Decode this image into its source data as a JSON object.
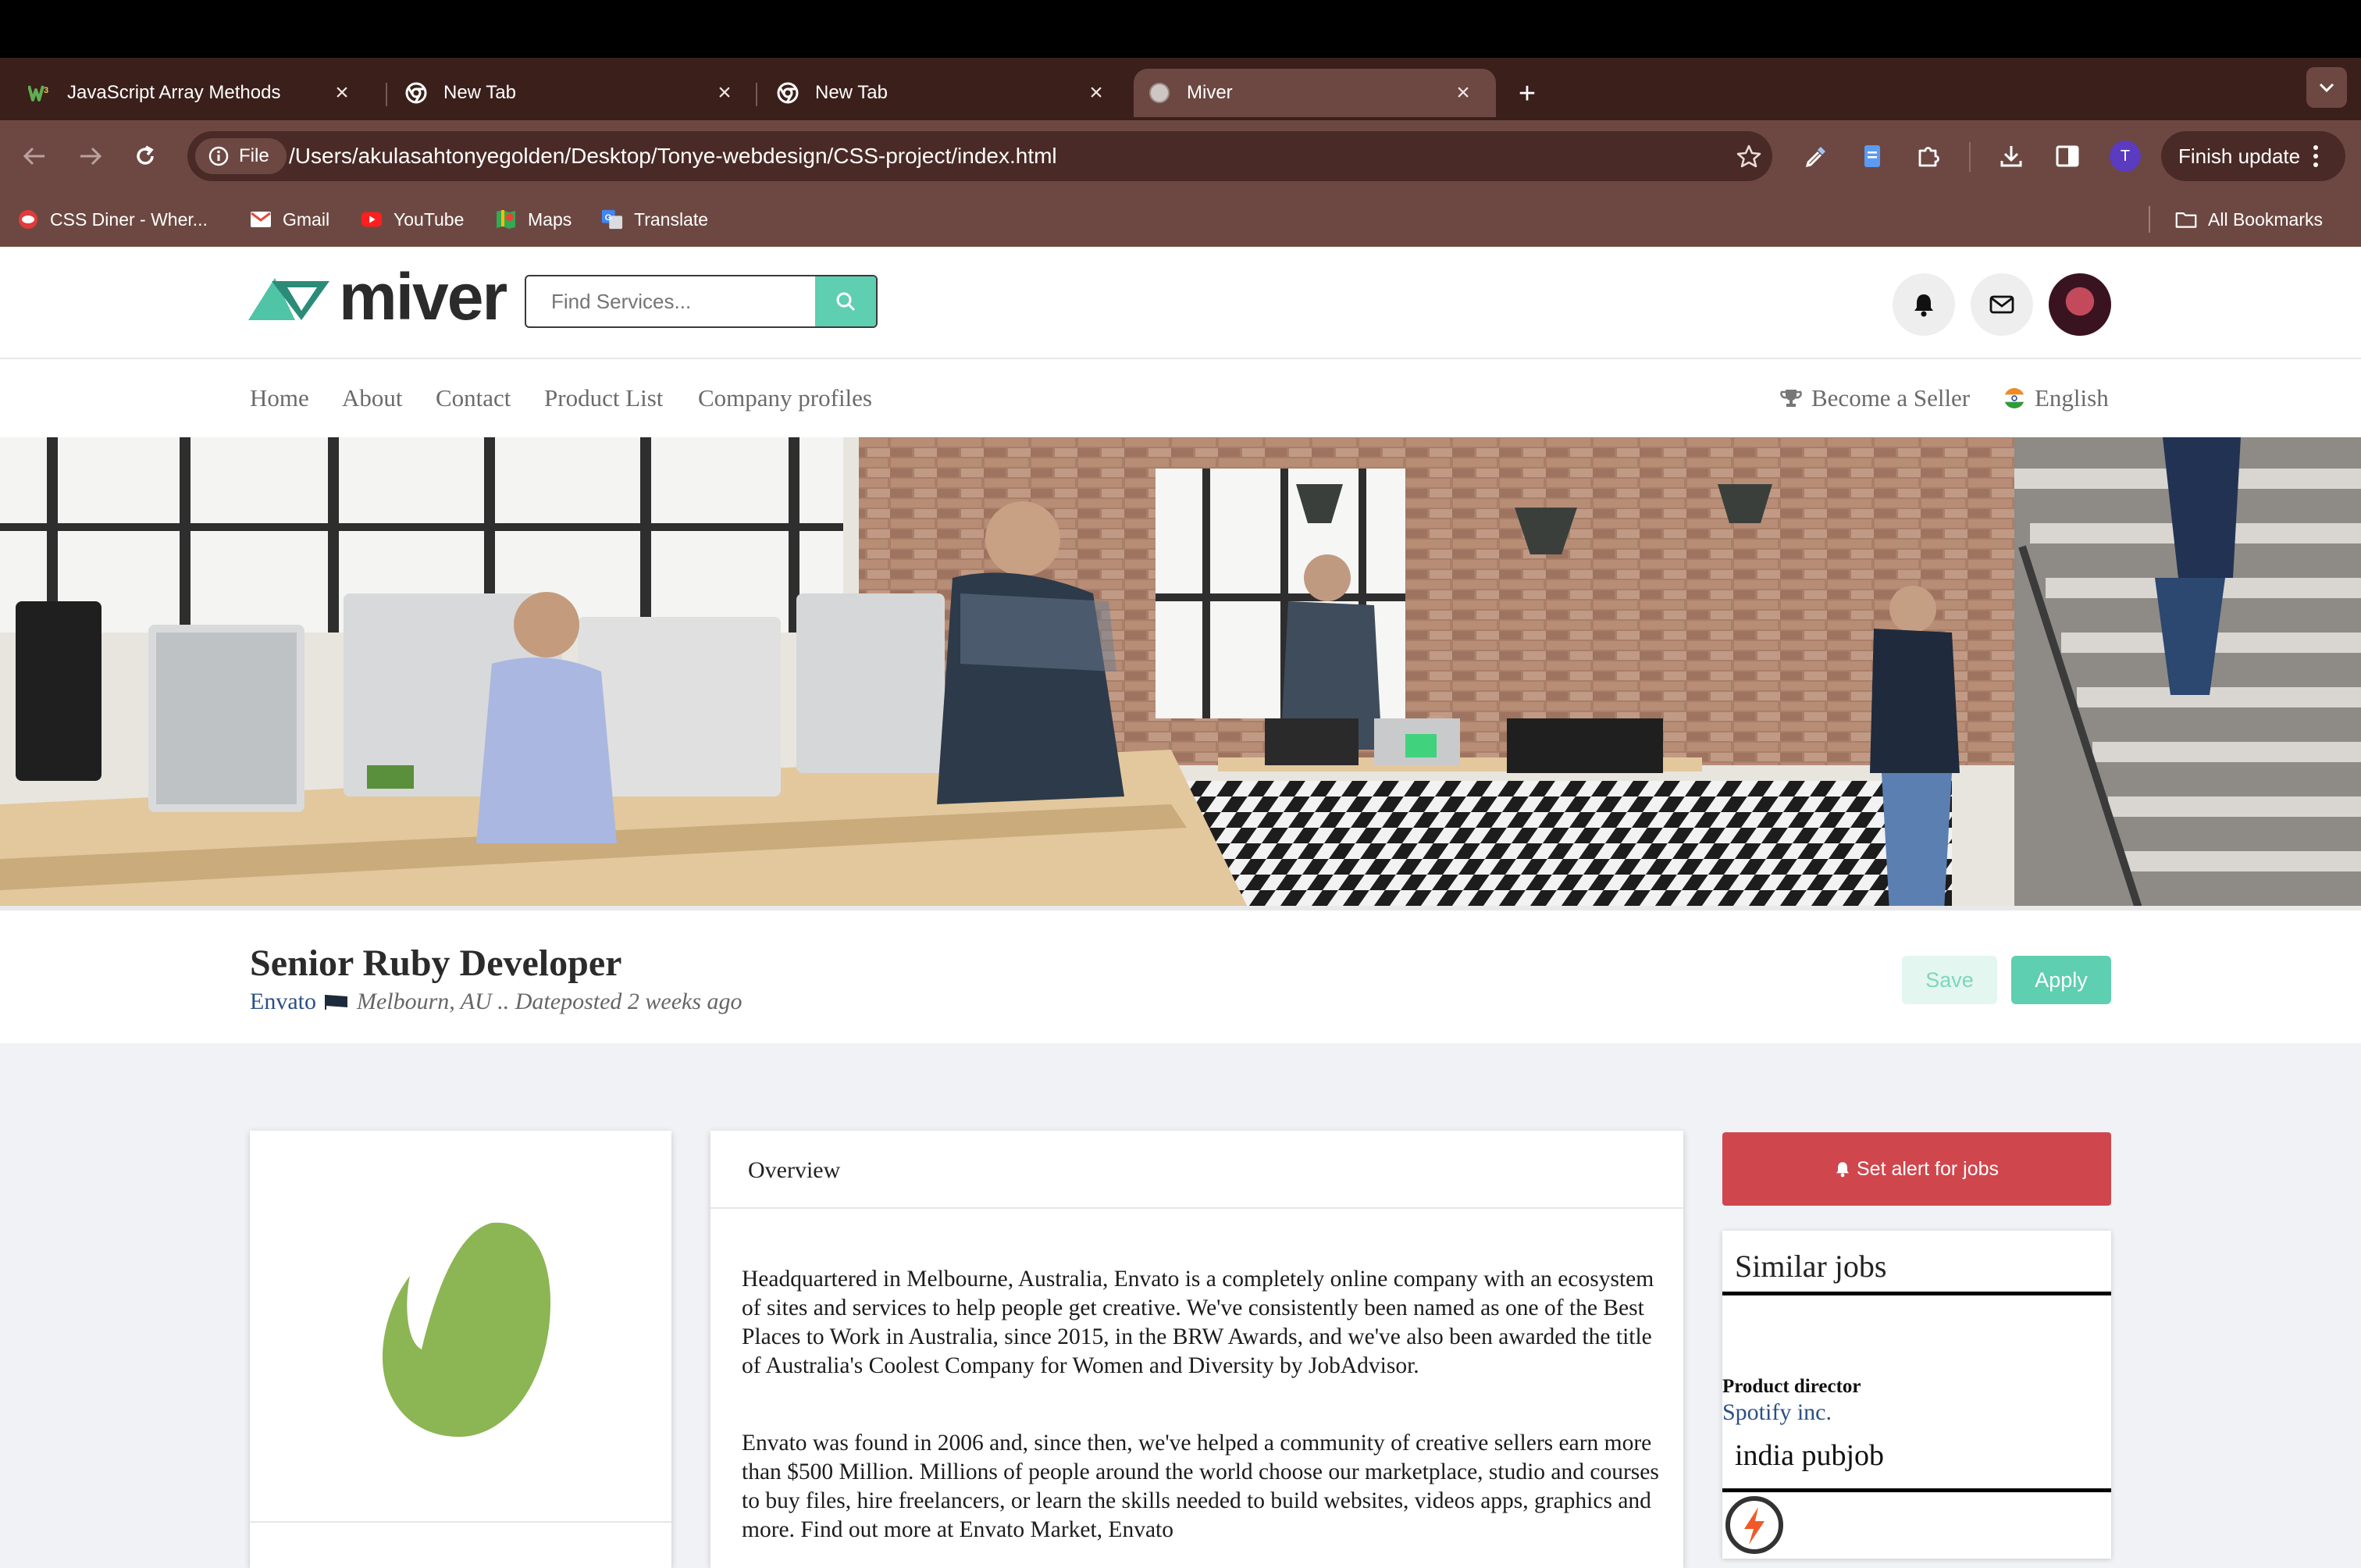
{
  "browser": {
    "tabs": [
      {
        "title": "JavaScript Array Methods",
        "active": false,
        "favicon": "w3-icon"
      },
      {
        "title": "New Tab",
        "active": false,
        "favicon": "chrome-icon"
      },
      {
        "title": "New Tab",
        "active": false,
        "favicon": "chrome-icon"
      },
      {
        "title": "Miver",
        "active": true,
        "favicon": "globe-icon"
      }
    ],
    "address": {
      "chip_label": "File",
      "url": "/Users/akulasahtonyegolden/Desktop/Tonye-webdesign/CSS-project/index.html"
    },
    "profile_initial": "T",
    "finish_update_label": "Finish update",
    "bookmarks": [
      {
        "label": "CSS Diner - Wher...",
        "icon": "css-diner-icon"
      },
      {
        "label": "Gmail",
        "icon": "gmail-icon"
      },
      {
        "label": "YouTube",
        "icon": "youtube-icon"
      },
      {
        "label": "Maps",
        "icon": "maps-icon"
      },
      {
        "label": "Translate",
        "icon": "translate-icon"
      }
    ],
    "all_bookmarks_label": "All Bookmarks",
    "colors": {
      "tab_strip": "#3b1f1b",
      "toolbar": "#6d4842"
    }
  },
  "site": {
    "logo_text": "miver",
    "search": {
      "placeholder": "Find Services..."
    },
    "nav": [
      "Home",
      "About",
      "Contact",
      "Product List",
      "Company profiles"
    ],
    "become_seller": "Become a Seller",
    "language": "English",
    "accent_color": "#5ecfb1"
  },
  "job": {
    "title": "Senior Ruby Developer",
    "company": "Envato",
    "location_posted": "Melbourn, AU .. Dateposted 2 weeks ago",
    "save_label": "Save",
    "apply_label": "Apply"
  },
  "overview": {
    "heading": "Overview",
    "paragraphs": [
      "Headquartered in Melbourne, Australia, Envato is a completely online company with an ecosystem of sites and services to help people get creative. We've consistently been named as one of the Best Places to Work in Australia, since 2015, in the BRW Awards, and we've also been awarded the title of Australia's Coolest Company for Women and Diversity by JobAdvisor.",
      "Envato was found in 2006 and, since then, we've helped a community of creative sellers earn more than $500 Million. Millions of people around the world choose our marketplace, studio and courses to buy files, hire freelancers, or learn the skills needed to build websites, videos apps, graphics and more. Find out more at Envato Market, Envato"
    ]
  },
  "sidebar": {
    "alert_label": "Set alert for jobs",
    "alert_color": "#d0464d",
    "similar_title": "Similar jobs",
    "jobs": [
      {
        "title": "Product director",
        "company": "Spotify inc."
      },
      {
        "title": "india pubjob"
      }
    ]
  }
}
